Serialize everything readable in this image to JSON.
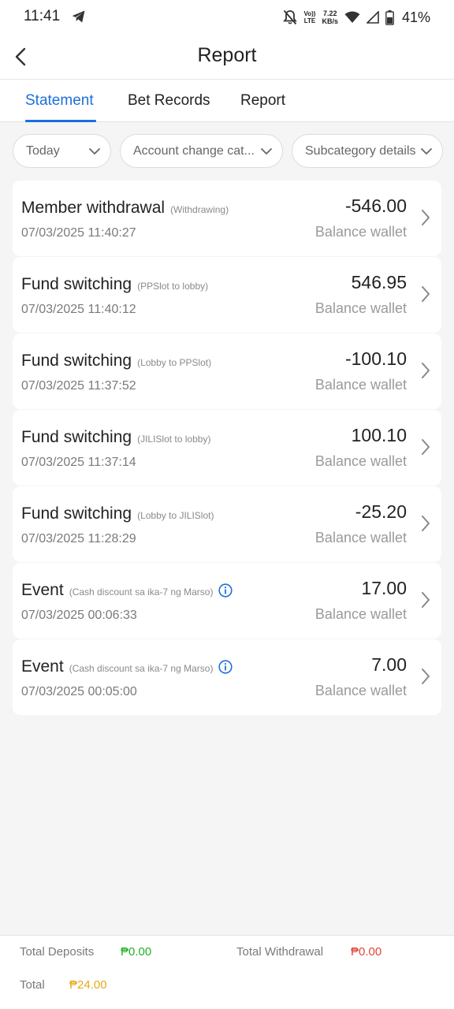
{
  "status_bar": {
    "time": "11:41",
    "net_speed_value": "7.22",
    "net_speed_unit": "KB/s",
    "volte_top": "Vo))",
    "volte_bottom": "LTE",
    "battery": "41%"
  },
  "header": {
    "title": "Report"
  },
  "tabs": [
    {
      "label": "Statement",
      "active": true
    },
    {
      "label": "Bet Records",
      "active": false
    },
    {
      "label": "Report",
      "active": false
    }
  ],
  "filters": [
    {
      "label": "Today"
    },
    {
      "label": "Account change cat..."
    },
    {
      "label": "Subcategory details"
    }
  ],
  "records": [
    {
      "title": "Member withdrawal",
      "subtitle": "(Withdrawing)",
      "date": "07/03/2025 11:40:27",
      "amount": "-546.00",
      "wallet": "Balance wallet",
      "info_icon": false
    },
    {
      "title": "Fund switching",
      "subtitle": "(PPSlot to lobby)",
      "date": "07/03/2025 11:40:12",
      "amount": "546.95",
      "wallet": "Balance wallet",
      "info_icon": false
    },
    {
      "title": "Fund switching",
      "subtitle": "(Lobby to PPSlot)",
      "date": "07/03/2025 11:37:52",
      "amount": "-100.10",
      "wallet": "Balance wallet",
      "info_icon": false
    },
    {
      "title": "Fund switching",
      "subtitle": "(JILISlot to lobby)",
      "date": "07/03/2025 11:37:14",
      "amount": "100.10",
      "wallet": "Balance wallet",
      "info_icon": false
    },
    {
      "title": "Fund switching",
      "subtitle": "(Lobby to JILISlot)",
      "date": "07/03/2025 11:28:29",
      "amount": "-25.20",
      "wallet": "Balance wallet",
      "info_icon": false
    },
    {
      "title": "Event",
      "subtitle": "(Cash discount sa ika-7 ng Marso)",
      "date": "07/03/2025 00:06:33",
      "amount": "17.00",
      "wallet": "Balance wallet",
      "info_icon": true
    },
    {
      "title": "Event",
      "subtitle": "(Cash discount sa ika-7 ng Marso)",
      "date": "07/03/2025 00:05:00",
      "amount": "7.00",
      "wallet": "Balance wallet",
      "info_icon": true
    }
  ],
  "footer": {
    "deposits_label": "Total Deposits",
    "deposits_value": "₱0.00",
    "withdrawal_label": "Total Withdrawal",
    "withdrawal_value": "₱0.00",
    "total_label": "Total",
    "total_value": "₱24.00"
  },
  "colors": {
    "accent": "#1e6fd9",
    "deposit": "#1fb31f",
    "withdrawal": "#e0443a",
    "total": "#e8a817"
  }
}
